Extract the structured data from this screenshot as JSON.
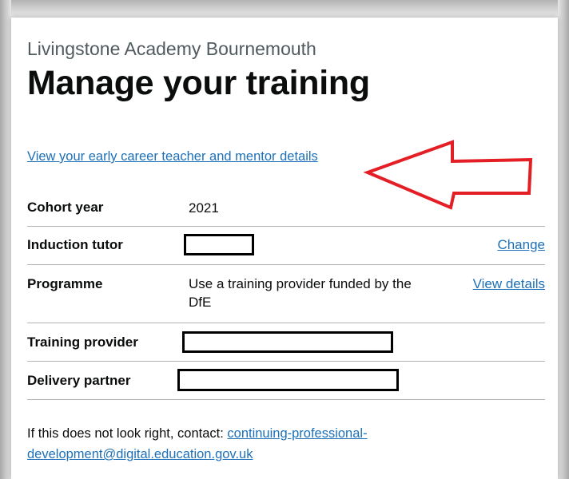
{
  "school_name": "Livingstone Academy Bournemouth",
  "page_title": "Manage your training",
  "view_details_link": "View your early career teacher and mentor details",
  "summary": {
    "cohort": {
      "key": "Cohort year",
      "value": "2021"
    },
    "induction_tutor": {
      "key": "Induction tutor",
      "action": "Change"
    },
    "programme": {
      "key": "Programme",
      "value": "Use a training provider funded by the DfE",
      "action": "View details"
    },
    "training_provider": {
      "key": "Training provider"
    },
    "delivery_partner": {
      "key": "Delivery partner"
    }
  },
  "footer": {
    "text": "If this does not look right, contact: ",
    "email": "continuing-professional-development@digital.education.gov.uk"
  },
  "colors": {
    "link": "#1d70b8",
    "annotation_arrow": "#e41e25",
    "text": "#0b0c0c",
    "border": "#b1b4b6"
  }
}
